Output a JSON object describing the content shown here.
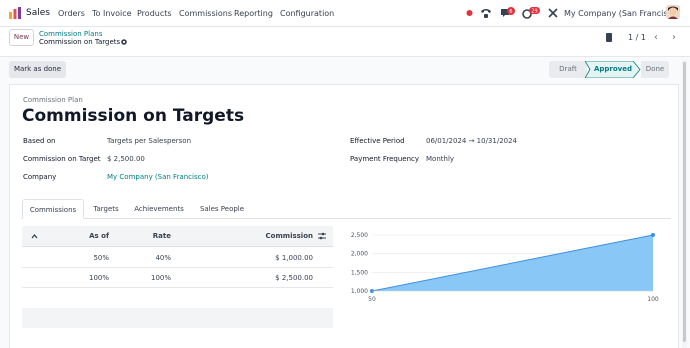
{
  "navbar": {
    "app_name": "Sales",
    "menu": [
      "Orders",
      "To Invoice",
      "Products",
      "Commissions",
      "Reporting",
      "Configuration"
    ],
    "company": "My Company (San Francisco)",
    "badge_messages": "6",
    "badge_activities": "29"
  },
  "controlpanel": {
    "new_label": "New",
    "breadcrumb_parent": "Commission Plans",
    "breadcrumb_current": "Commission on Targets",
    "pager": "1 / 1"
  },
  "statusbar": {
    "mark_done_label": "Mark as done",
    "stages": [
      "Draft",
      "Approved",
      "Done"
    ],
    "active_stage": "Approved"
  },
  "form": {
    "small_label": "Commission Plan",
    "title": "Commission on Targets",
    "fields_left": [
      {
        "label": "Based on",
        "value": "Targets per Salesperson"
      },
      {
        "label": "Commission on Target",
        "value": "$ 2,500.00"
      },
      {
        "label": "Company",
        "value": "My Company (San Francisco)"
      }
    ],
    "fields_right": [
      {
        "label": "Effective Period",
        "value": "06/01/2024 → 10/31/2024"
      },
      {
        "label": "Payment Frequency",
        "value": "Monthly"
      }
    ]
  },
  "tabs": [
    "Commissions",
    "Targets",
    "Achievements",
    "Sales People"
  ],
  "table": {
    "headers": [
      "As of",
      "Rate",
      "Commission"
    ],
    "rows": [
      [
        "50%",
        "40%",
        "$ 1,000.00"
      ],
      [
        "100%",
        "100%",
        "$ 2,500.00"
      ]
    ]
  },
  "chart_data": {
    "type": "area",
    "x": [
      50,
      100
    ],
    "values": [
      1000,
      2500
    ],
    "xlim": [
      50,
      100
    ],
    "ylim": [
      1000,
      2500
    ],
    "y_ticks": [
      "2,500",
      "2,000",
      "1,500",
      "1,000"
    ],
    "x_ticks": [
      "50",
      "100"
    ],
    "color": "#82c4f5",
    "line_color": "#3b8fdd",
    "grid": true
  }
}
